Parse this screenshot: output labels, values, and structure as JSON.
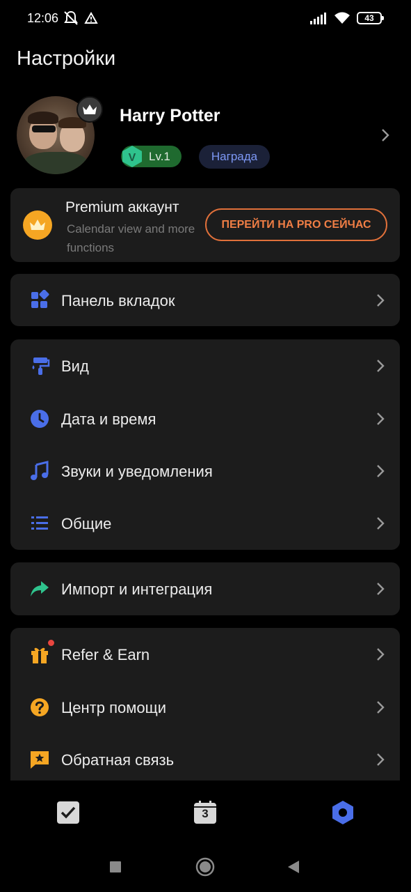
{
  "status_bar": {
    "time": "12:06",
    "battery": "43",
    "icons": [
      "dnd-off-icon",
      "alert-icon",
      "signal-icon",
      "wifi-icon",
      "battery-icon"
    ]
  },
  "page_title": "Настройки",
  "profile": {
    "name": "Harry Potter",
    "level": "Lv.1",
    "reward_label": "Награда"
  },
  "premium": {
    "title": "Premium аккаунт",
    "subtitle": "Calendar view and more functions",
    "button_label": "ПЕРЕЙТИ НА PRO СЕЙЧАС"
  },
  "menu": {
    "tab_bar": "Панель вкладок",
    "view": "Вид",
    "date_time": "Дата и время",
    "sounds": "Звуки и уведомления",
    "general": "Общие",
    "import": "Импорт и интеграция",
    "refer": "Refer & Earn",
    "help": "Центр помощи",
    "feedback": "Обратная связь"
  },
  "bottom_nav": {
    "calendar_day": "3",
    "items": [
      "tasks-tab",
      "calendar-tab",
      "settings-tab"
    ],
    "active": "settings-tab"
  },
  "colors": {
    "accent_blue": "#4a6ee8",
    "premium_orange": "#f07e45",
    "level_green": "#1f6a2f",
    "import_green": "#2fc38d",
    "gold": "#f5a623"
  }
}
